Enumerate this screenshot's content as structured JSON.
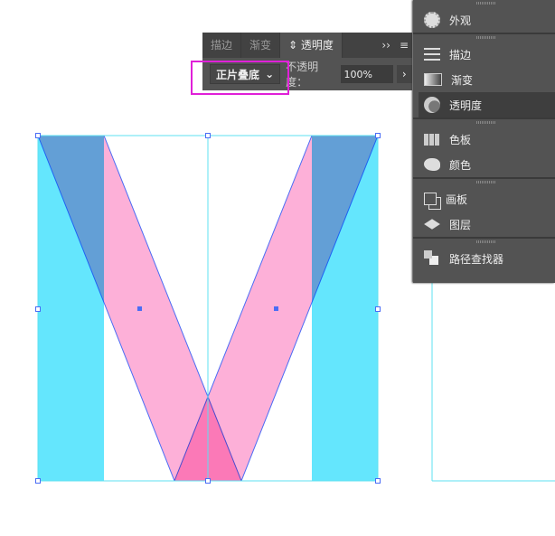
{
  "transparency_panel": {
    "tabs": [
      "描边",
      "渐变",
      "透明度"
    ],
    "active_tab": "透明度",
    "more": "››",
    "menu": "≡",
    "blend_mode": "正片叠底",
    "opacity_label": "不透明度：",
    "opacity_value": "100%",
    "opacity_arrow": "›"
  },
  "side_panel": {
    "groups": [
      [
        {
          "label": "外观",
          "icon": "appearance-icon"
        }
      ],
      [
        {
          "label": "描边",
          "icon": "stroke-icon"
        },
        {
          "label": "渐变",
          "icon": "gradient-icon"
        },
        {
          "label": "透明度",
          "icon": "transparency-icon",
          "active": true
        }
      ],
      [
        {
          "label": "色板",
          "icon": "swatches-icon"
        },
        {
          "label": "颜色",
          "icon": "color-palette-icon"
        }
      ],
      [
        {
          "label": "画板",
          "icon": "artboards-icon"
        },
        {
          "label": "图层",
          "icon": "layers-icon"
        }
      ],
      [
        {
          "label": "路径查找器",
          "icon": "pathfinder-icon"
        }
      ]
    ]
  },
  "colors": {
    "cyan": "#64e6fd",
    "pink": "#fdb0d8",
    "selection": "#4a6cf5",
    "highlight": "#e020d8",
    "guide": "#5ee0f0"
  }
}
